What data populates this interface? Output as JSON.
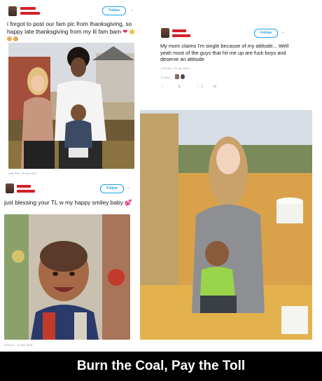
{
  "tweet1": {
    "follow_label": "Follow",
    "text": "i forgot to post our fam pic from thanksgiving, so happy late thanksgiving from my lil fam bam",
    "emoji": "❤",
    "timestamp": "5:56 PM - 29 Nov 2017"
  },
  "tweet2": {
    "follow_label": "Follow",
    "text": "My mom claims I'm single because of my attitude... Well yeah most of the guys that hit me up are fuck boys and deserve an attitude",
    "timestamp": "1:03 AM - 15 Jan 2019",
    "likes_label": "3 Likes",
    "reply_count": "1"
  },
  "tweet3": {
    "follow_label": "Follow",
    "text": "just blessing your TL w my happy smiley baby",
    "emoji": "💕",
    "timestamp": "3:59 pm - 13 Mar 2018"
  },
  "caption": "Burn the Coal, Pay the Toll",
  "colors": {
    "accent": "#1da1f2",
    "name_redaction": "#d4202a",
    "footer_bg": "#000000"
  }
}
